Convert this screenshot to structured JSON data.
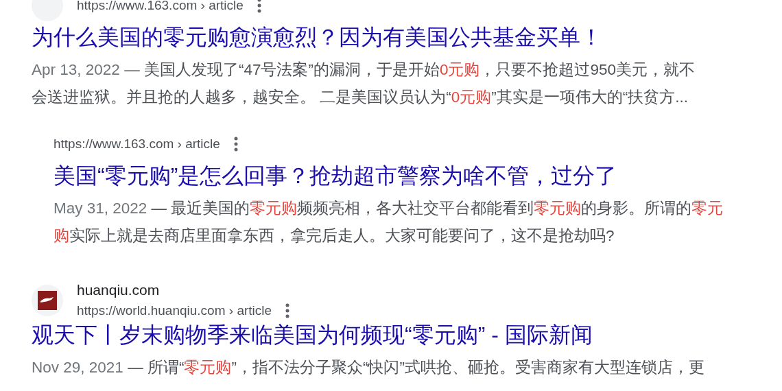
{
  "results": [
    {
      "kind": "main",
      "url": "https://www.163.com › article",
      "title": "为什么美国的零元购愈演愈烈？因为有美国公共基金买单！",
      "date": "Apr 13, 2022",
      "separator": "—",
      "snippet": [
        [
          {
            "text": "美国人发现了“47号法案”的漏洞，于是开始",
            "highlight": false
          },
          {
            "text": "0元购",
            "highlight": true
          },
          {
            "text": "，只要不抢超过950美元，就不",
            "highlight": false
          }
        ],
        [
          {
            "text": "会送进监狱。并且抢的人越多，越安全。 二是美国议员认为“",
            "highlight": false
          },
          {
            "text": "0元购",
            "highlight": true
          },
          {
            "text": "”其实是一项伟大的“扶贫方...",
            "highlight": false
          }
        ]
      ]
    },
    {
      "kind": "sub",
      "url": "https://www.163.com › article",
      "title": "美国“零元购”是怎么回事？抢劫超市警察为啥不管，过分了",
      "date": "May 31, 2022",
      "separator": "—",
      "snippet": [
        [
          {
            "text": "最近美国的",
            "highlight": false
          },
          {
            "text": "零元购",
            "highlight": true
          },
          {
            "text": "频频亮相，各大社交平台都能看到",
            "highlight": false
          },
          {
            "text": "零元购",
            "highlight": true
          },
          {
            "text": "的身影。所谓的",
            "highlight": false
          },
          {
            "text": "零元",
            "highlight": true
          }
        ],
        [
          {
            "text": "购",
            "highlight": true
          },
          {
            "text": "实际上就是去商店里面拿东西，拿完后走人。大家可能要问了，这不是抢劫吗?",
            "highlight": false
          }
        ]
      ]
    },
    {
      "kind": "main",
      "site": "huanqiu.com",
      "url": "https://world.huanqiu.com › article",
      "title": "观天下丨岁末购物季来临美国为何频现“零元购” - 国际新闻",
      "date": "Nov 29, 2021",
      "separator": "—",
      "snippet": [
        [
          {
            "text": "所谓“",
            "highlight": false
          },
          {
            "text": "零元购",
            "highlight": true
          },
          {
            "text": "”，指不法分子聚众“快闪”式哄抢、砸抢。受害商家有大型连锁店，更",
            "highlight": false
          }
        ]
      ]
    }
  ]
}
